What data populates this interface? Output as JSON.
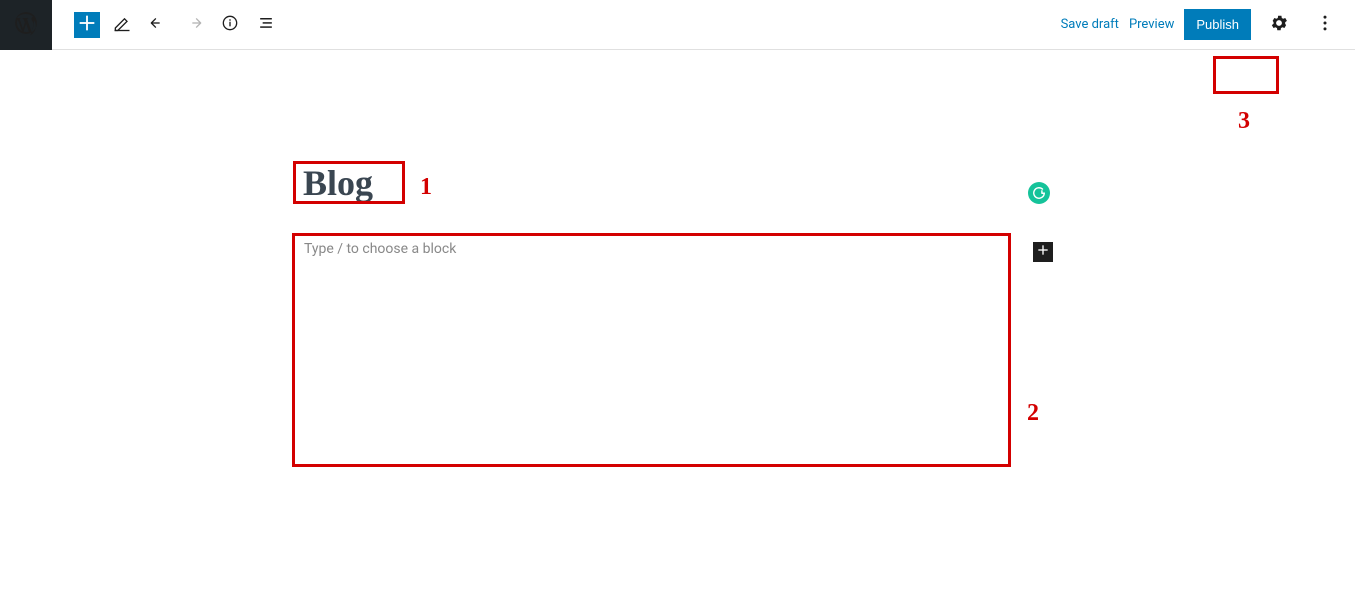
{
  "toolbar": {
    "add_block": "+",
    "save_draft": "Save draft",
    "preview": "Preview",
    "publish": "Publish"
  },
  "editor": {
    "title": "Blog",
    "content_placeholder": "Type / to choose a block"
  },
  "annotations": {
    "n1": "1",
    "n2": "2",
    "n3": "3"
  }
}
